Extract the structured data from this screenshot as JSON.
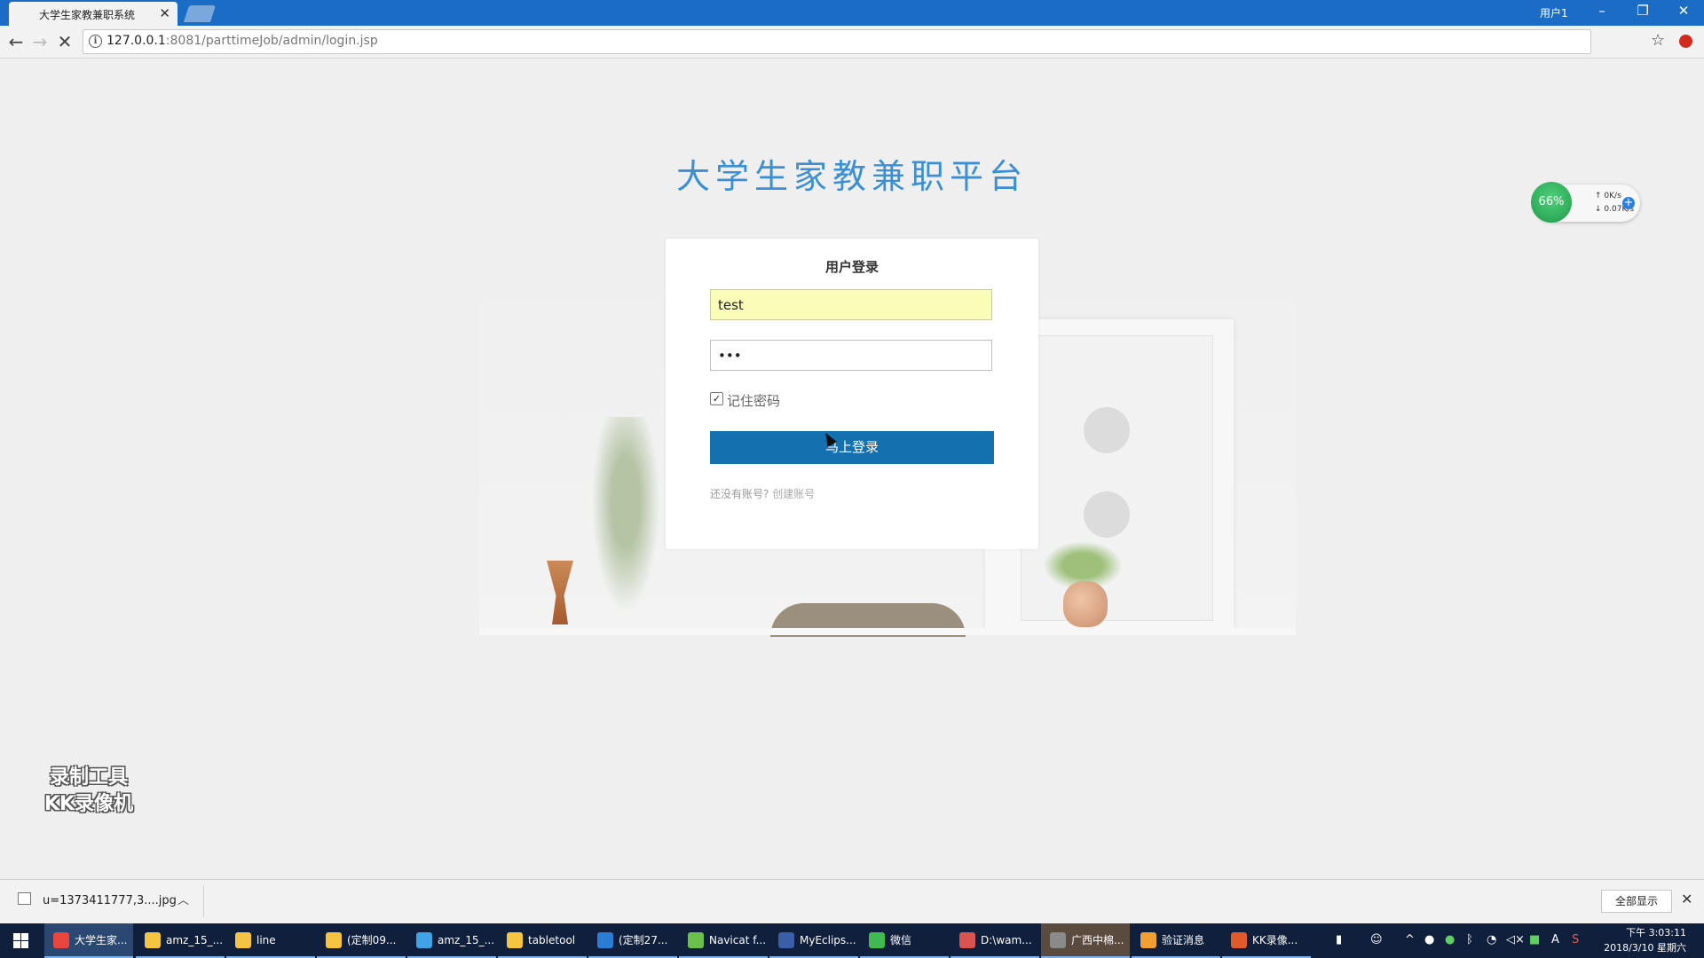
{
  "browser": {
    "tab_title": "大学生家教兼职系统",
    "user_label": "用户1",
    "url_host": "127.0.0.1",
    "url_rest": ":8081/parttimeJob/admin/login.jsp",
    "window_controls": [
      "–",
      "❐",
      "✕"
    ]
  },
  "page": {
    "site_title": "大学生家教兼职平台",
    "login": {
      "heading": "用户登录",
      "username_value": "test",
      "password_value": "•••",
      "remember_checked": true,
      "remember_label": "记住密码",
      "submit_label": "马上登录",
      "no_account_text": "还没有账号?",
      "create_account_link": "创建账号"
    },
    "net_widget": {
      "percent": "66%",
      "upload_speed": "0K/s",
      "download_speed": "0.07K/s"
    },
    "watermark": [
      "录制工具",
      "KK录像机"
    ]
  },
  "download_bar": {
    "file_name": "u=1373411777,3....jpg",
    "show_all_label": "全部显示"
  },
  "taskbar": {
    "items": [
      {
        "label": "大学生家...",
        "icon": "chrome-icon",
        "color": "#e8453c"
      },
      {
        "label": "amz_15_...",
        "icon": "folder-icon",
        "color": "#f5c542"
      },
      {
        "label": "line",
        "icon": "folder-icon",
        "color": "#f5c542"
      },
      {
        "label": "(定制09...",
        "icon": "folder-icon",
        "color": "#f5c542"
      },
      {
        "label": "amz_15_...",
        "icon": "cube-icon",
        "color": "#3fa3e6"
      },
      {
        "label": "tabletool",
        "icon": "folder-icon",
        "color": "#f5c542"
      },
      {
        "label": "(定制27...",
        "icon": "word-icon",
        "color": "#2b7cd3"
      },
      {
        "label": "Navicat f...",
        "icon": "navicat-icon",
        "color": "#6bc04b"
      },
      {
        "label": "MyEclips...",
        "icon": "eclipse-icon",
        "color": "#3a5fa8"
      },
      {
        "label": "微信",
        "icon": "wechat-icon",
        "color": "#3fb950"
      },
      {
        "label": "D:\\wam...",
        "icon": "folder-red-icon",
        "color": "#d9534f"
      },
      {
        "label": "广西中棉...",
        "icon": "phone-icon",
        "color": "#8a8a8a"
      },
      {
        "label": "验证消息",
        "icon": "message-icon",
        "color": "#f0a030"
      },
      {
        "label": "KK录像...",
        "icon": "kk-recorder-icon",
        "color": "#e05a2a"
      }
    ],
    "clock_time": "下午 3:03:11",
    "clock_date": "2018/3/10 星期六"
  }
}
